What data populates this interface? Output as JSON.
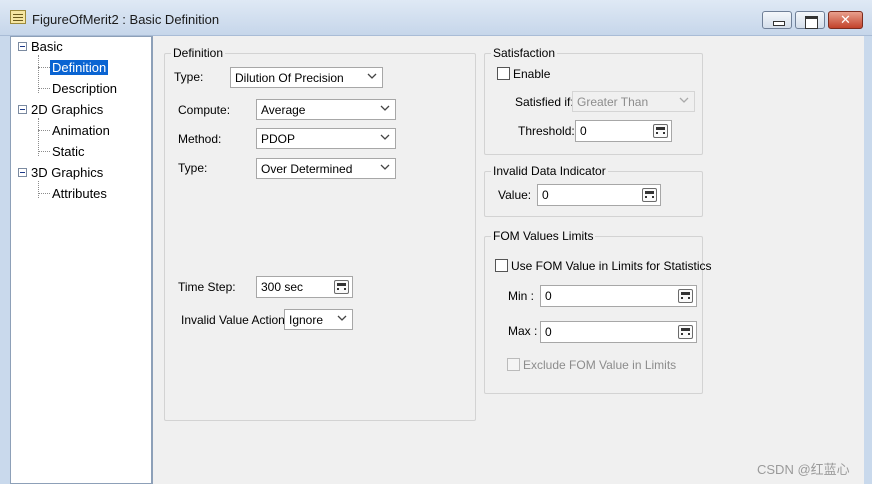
{
  "window": {
    "title": "FigureOfMerit2 : Basic Definition"
  },
  "tree": {
    "items": [
      {
        "label": "Basic",
        "expander": "collapse-icon"
      },
      {
        "label": "Definition",
        "selected": true
      },
      {
        "label": "Description"
      },
      {
        "label": "2D Graphics",
        "expander": "collapse-icon"
      },
      {
        "label": "Animation"
      },
      {
        "label": "Static"
      },
      {
        "label": "3D Graphics",
        "expander": "collapse-icon"
      },
      {
        "label": "Attributes"
      }
    ]
  },
  "definition": {
    "title": "Definition",
    "type_label": "Type:",
    "type_value": "Dilution Of Precision",
    "compute_label": "Compute:",
    "compute_value": "Average",
    "method_label": "Method:",
    "method_value": "PDOP",
    "type2_label": "Type:",
    "type2_value": "Over Determined",
    "timestep_label": "Time Step:",
    "timestep_value": "300 sec",
    "invalid_label": "Invalid Value Action:",
    "invalid_value": "Ignore"
  },
  "satisfaction": {
    "title": "Satisfaction",
    "enable_label": "Enable",
    "satisfied_label": "Satisfied if:",
    "satisfied_value": "Greater Than",
    "threshold_label": "Threshold:",
    "threshold_value": "0"
  },
  "invalid_indicator": {
    "title": "Invalid Data Indicator",
    "value_label": "Value:",
    "value": "0"
  },
  "fom_limits": {
    "title": "FOM Values Limits",
    "use_label": "Use FOM Value in Limits for Statistics",
    "min_label": "Min :",
    "min_value": "0",
    "max_label": "Max :",
    "max_value": "0",
    "exclude_label": "Exclude FOM Value in Limits"
  },
  "watermark": "CSDN @红蓝心",
  "colors": {
    "selection": "#0a64d2",
    "panel": "#f0f0f0",
    "frame": "#c9d9ec"
  }
}
